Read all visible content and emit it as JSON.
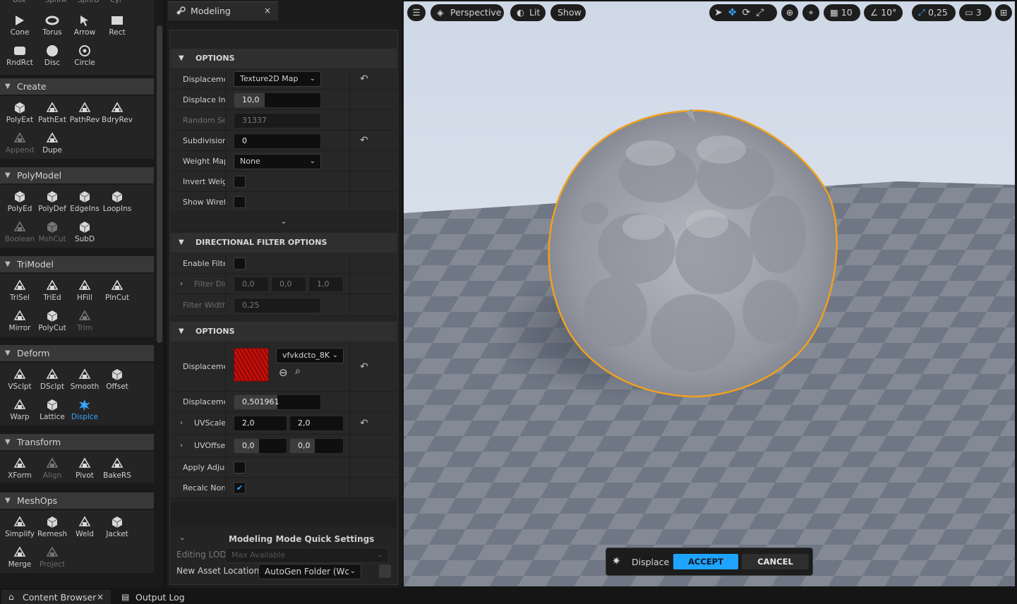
{
  "palette": {
    "top_row_partial": [
      "Box",
      "SphrA",
      "SphrD",
      "Cyl"
    ],
    "shapes": [
      {
        "label": "Cone",
        "icon": "cone-icon",
        "state": "normal"
      },
      {
        "label": "Torus",
        "icon": "torus-icon",
        "state": "normal"
      },
      {
        "label": "Arrow",
        "icon": "arrow-icon",
        "state": "normal"
      },
      {
        "label": "Rect",
        "icon": "rect-icon",
        "state": "normal"
      },
      {
        "label": "RndRct",
        "icon": "rounded-rect-icon",
        "state": "normal"
      },
      {
        "label": "Disc",
        "icon": "disc-icon",
        "state": "normal"
      },
      {
        "label": "Circle",
        "icon": "circle-icon",
        "state": "normal"
      }
    ],
    "categories": [
      {
        "title": "Create",
        "tools": [
          {
            "label": "PolyExt",
            "icon": "poly-extrude-icon",
            "state": "normal"
          },
          {
            "label": "PathExt",
            "icon": "path-extrude-icon",
            "state": "normal"
          },
          {
            "label": "PathRev",
            "icon": "path-revolve-icon",
            "state": "normal"
          },
          {
            "label": "BdryRev",
            "icon": "boundary-revolve-icon",
            "state": "normal"
          },
          {
            "label": "Append",
            "icon": "append-icon",
            "state": "disabled"
          },
          {
            "label": "Dupe",
            "icon": "duplicate-icon",
            "state": "normal"
          }
        ]
      },
      {
        "title": "PolyModel",
        "tools": [
          {
            "label": "PolyEd",
            "icon": "poly-edit-icon",
            "state": "normal"
          },
          {
            "label": "PolyDef",
            "icon": "poly-deform-icon",
            "state": "normal"
          },
          {
            "label": "EdgeIns",
            "icon": "edge-insert-icon",
            "state": "normal"
          },
          {
            "label": "LoopIns",
            "icon": "loop-insert-icon",
            "state": "normal"
          },
          {
            "label": "Boolean",
            "icon": "boolean-icon",
            "state": "disabled"
          },
          {
            "label": "MshCut",
            "icon": "mesh-cut-icon",
            "state": "disabled"
          },
          {
            "label": "SubD",
            "icon": "subdivide-icon",
            "state": "normal"
          }
        ]
      },
      {
        "title": "TriModel",
        "tools": [
          {
            "label": "TriSel",
            "icon": "tri-select-icon",
            "state": "normal"
          },
          {
            "label": "TriEd",
            "icon": "tri-edit-icon",
            "state": "normal"
          },
          {
            "label": "HFill",
            "icon": "hole-fill-icon",
            "state": "normal"
          },
          {
            "label": "PlnCut",
            "icon": "plane-cut-icon",
            "state": "normal"
          },
          {
            "label": "Mirror",
            "icon": "mirror-icon",
            "state": "normal"
          },
          {
            "label": "PolyCut",
            "icon": "poly-cut-icon",
            "state": "normal"
          },
          {
            "label": "Trim",
            "icon": "trim-icon",
            "state": "disabled"
          }
        ]
      },
      {
        "title": "Deform",
        "tools": [
          {
            "label": "VSclpt",
            "icon": "vertex-sculpt-icon",
            "state": "normal"
          },
          {
            "label": "DSclpt",
            "icon": "dyna-sculpt-icon",
            "state": "normal"
          },
          {
            "label": "Smooth",
            "icon": "smooth-icon",
            "state": "normal"
          },
          {
            "label": "Offset",
            "icon": "offset-icon",
            "state": "normal"
          },
          {
            "label": "Warp",
            "icon": "warp-icon",
            "state": "normal"
          },
          {
            "label": "Lattice",
            "icon": "lattice-icon",
            "state": "normal"
          },
          {
            "label": "Displce",
            "icon": "displace-icon",
            "state": "active"
          }
        ]
      },
      {
        "title": "Transform",
        "tools": [
          {
            "label": "XForm",
            "icon": "transform-icon",
            "state": "normal"
          },
          {
            "label": "Align",
            "icon": "align-icon",
            "state": "disabled"
          },
          {
            "label": "Pivot",
            "icon": "pivot-icon",
            "state": "normal"
          },
          {
            "label": "BakeRS",
            "icon": "bake-rs-icon",
            "state": "normal"
          }
        ]
      },
      {
        "title": "MeshOps",
        "tools": [
          {
            "label": "Simplify",
            "icon": "simplify-icon",
            "state": "normal"
          },
          {
            "label": "Remesh",
            "icon": "remesh-icon",
            "state": "normal"
          },
          {
            "label": "Weld",
            "icon": "weld-icon",
            "state": "normal"
          },
          {
            "label": "Jacket",
            "icon": "jacket-icon",
            "state": "normal"
          },
          {
            "label": "Merge",
            "icon": "merge-icon",
            "state": "normal"
          },
          {
            "label": "Project",
            "icon": "project-icon",
            "state": "disabled"
          }
        ]
      }
    ]
  },
  "details": {
    "tab_title": "Modeling",
    "close_glyph": "×",
    "section1_title": "OPTIONS",
    "displacement_type": {
      "label": "Displaceme",
      "value": "Texture2D Map"
    },
    "displace_intensity": {
      "label": "Displace Int",
      "value": "10,0",
      "fill": 0.35
    },
    "random_seed": {
      "label": "Random See",
      "value": "31337"
    },
    "subdivisions": {
      "label": "Subdivision",
      "value": "0"
    },
    "weight_map": {
      "label": "Weight Map",
      "value": "None"
    },
    "invert_weight": {
      "label": "Invert Weigh",
      "checked": false
    },
    "show_wireframe": {
      "label": "Show Wirefr",
      "checked": false
    },
    "section2_title": "DIRECTIONAL FILTER OPTIONS",
    "enable_filter": {
      "label": "Enable Filte",
      "checked": false
    },
    "filter_direction": {
      "label": "Filter Dir",
      "x": "0,0",
      "y": "0,0",
      "z": "1,0"
    },
    "filter_width": {
      "label": "Filter Width",
      "value": "0,25"
    },
    "section3_title": "OPTIONS",
    "displacement_map": {
      "label": "Displaceme",
      "asset": "vfvkdcto_8K",
      "thumb_color": "#c4100a"
    },
    "displacement_channel": {
      "label": "Displaceme",
      "value": "0,501961",
      "fill": 0.5
    },
    "uv_scale": {
      "label": "UVScale",
      "u": "2,0",
      "v": "2,0"
    },
    "uv_offset": {
      "label": "UVOffse",
      "u": "0,0",
      "v": "0,0"
    },
    "apply_adjustment": {
      "label": "Apply Adjus",
      "checked": false
    },
    "recalc_normals": {
      "label": "Recalc Norr",
      "checked": true
    },
    "quick_settings": {
      "title": "Modeling Mode Quick Settings",
      "editing_lod_label": "Editing LOD",
      "editing_lod_value": "Max Available",
      "new_asset_label": "New Asset Location",
      "new_asset_value": "AutoGen Folder (Wc"
    }
  },
  "viewport": {
    "perspective_label": "Perspective",
    "lit_label": "Lit",
    "show_label": "Show",
    "grid_snap": "10",
    "angle_snap": "10°",
    "scale_snap": "0,25",
    "camera_speed": "3",
    "toast": {
      "tool": "Displace",
      "accept": "ACCEPT",
      "cancel": "CANCEL"
    },
    "selection_color": "#f0a020"
  },
  "bottom_tabs": [
    {
      "label": "Content Browser",
      "close": "×"
    },
    {
      "label": "Output Log"
    }
  ]
}
